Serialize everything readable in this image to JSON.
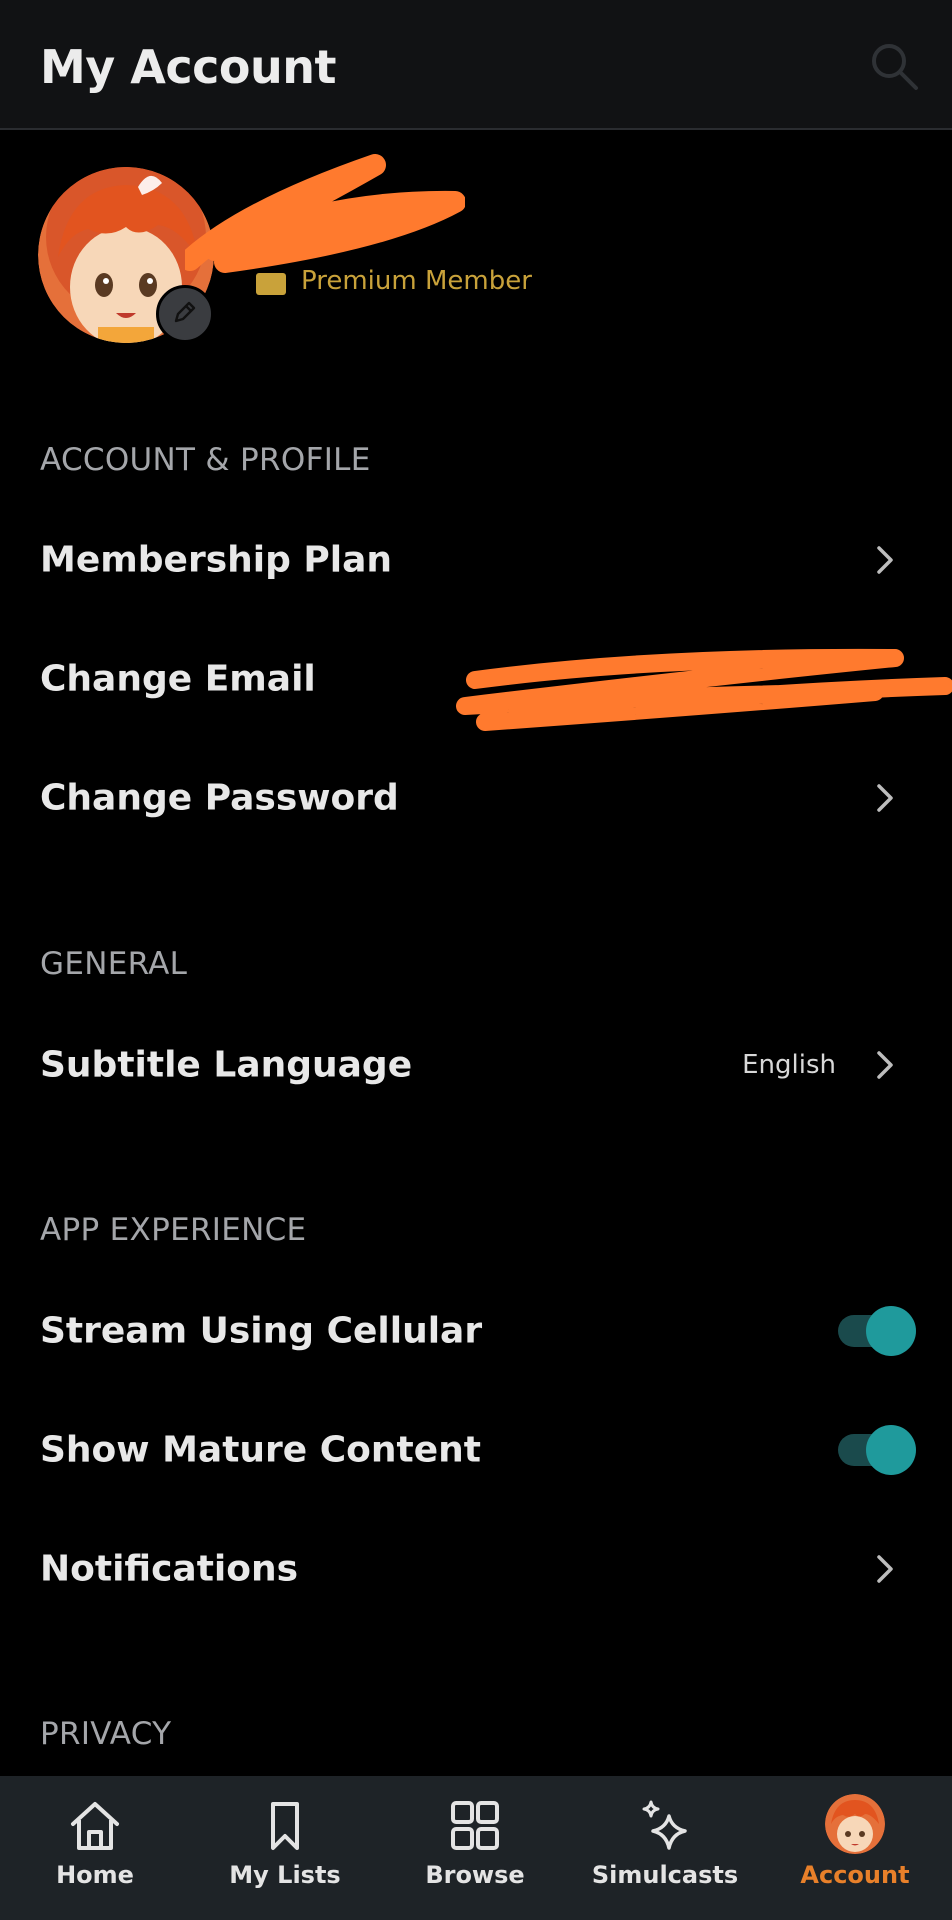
{
  "header": {
    "title": "My Account",
    "search_icon": "search-icon"
  },
  "profile": {
    "avatar_icon": "avatar",
    "edit_icon": "pencil-icon",
    "membership_label": "Premium Member",
    "accent_color": "#c9a23a"
  },
  "sections": {
    "account_profile": {
      "heading": "ACCOUNT & PROFILE",
      "items": [
        {
          "label": "Membership Plan"
        },
        {
          "label": "Change Email"
        },
        {
          "label": "Change Password"
        }
      ]
    },
    "general": {
      "heading": "GENERAL",
      "items": [
        {
          "label": "Subtitle Language",
          "value": "English"
        }
      ]
    },
    "app_experience": {
      "heading": "APP EXPERIENCE",
      "items": [
        {
          "label": "Stream Using Cellular",
          "toggle": true
        },
        {
          "label": "Show Mature Content",
          "toggle": true
        },
        {
          "label": "Notifications"
        }
      ]
    },
    "privacy": {
      "heading": "PRIVACY"
    }
  },
  "bottom_nav": {
    "items": [
      {
        "label": "Home",
        "icon": "home-icon"
      },
      {
        "label": "My Lists",
        "icon": "bookmark-icon"
      },
      {
        "label": "Browse",
        "icon": "grid-icon"
      },
      {
        "label": "Simulcasts",
        "icon": "sparkle-icon"
      },
      {
        "label": "Account",
        "icon": "avatar",
        "active": true
      }
    ],
    "active_color": "#e8802a"
  },
  "colors": {
    "background": "#000000",
    "toggle_on": "#1f9a9c",
    "redaction": "#ff7a2e"
  }
}
